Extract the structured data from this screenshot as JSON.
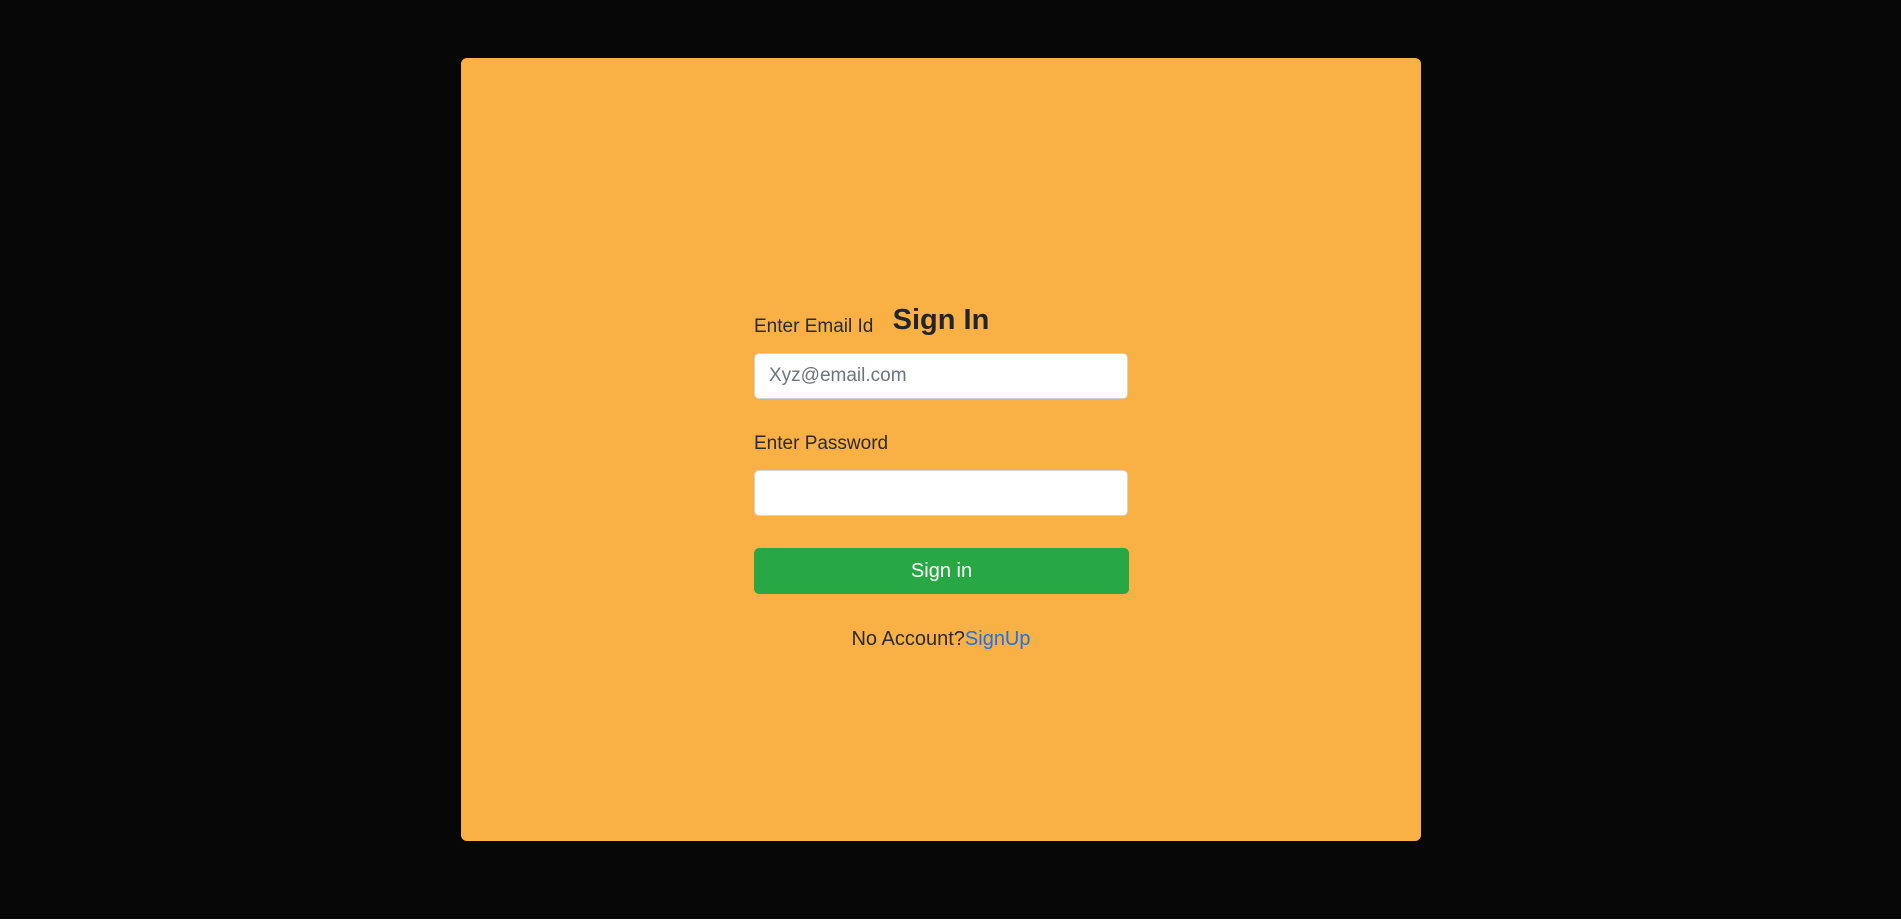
{
  "signin": {
    "title": "Sign In",
    "email_label": "Enter Email Id",
    "email_placeholder": "Xyz@email.com",
    "email_value": "",
    "password_label": "Enter Password",
    "password_value": "",
    "submit_label": "Sign in",
    "footer_text": "No Account?",
    "signup_link": "SignUp"
  },
  "colors": {
    "card": "#f9b044",
    "button": "#28a745",
    "link": "#1a73e8",
    "background": "#070707"
  }
}
